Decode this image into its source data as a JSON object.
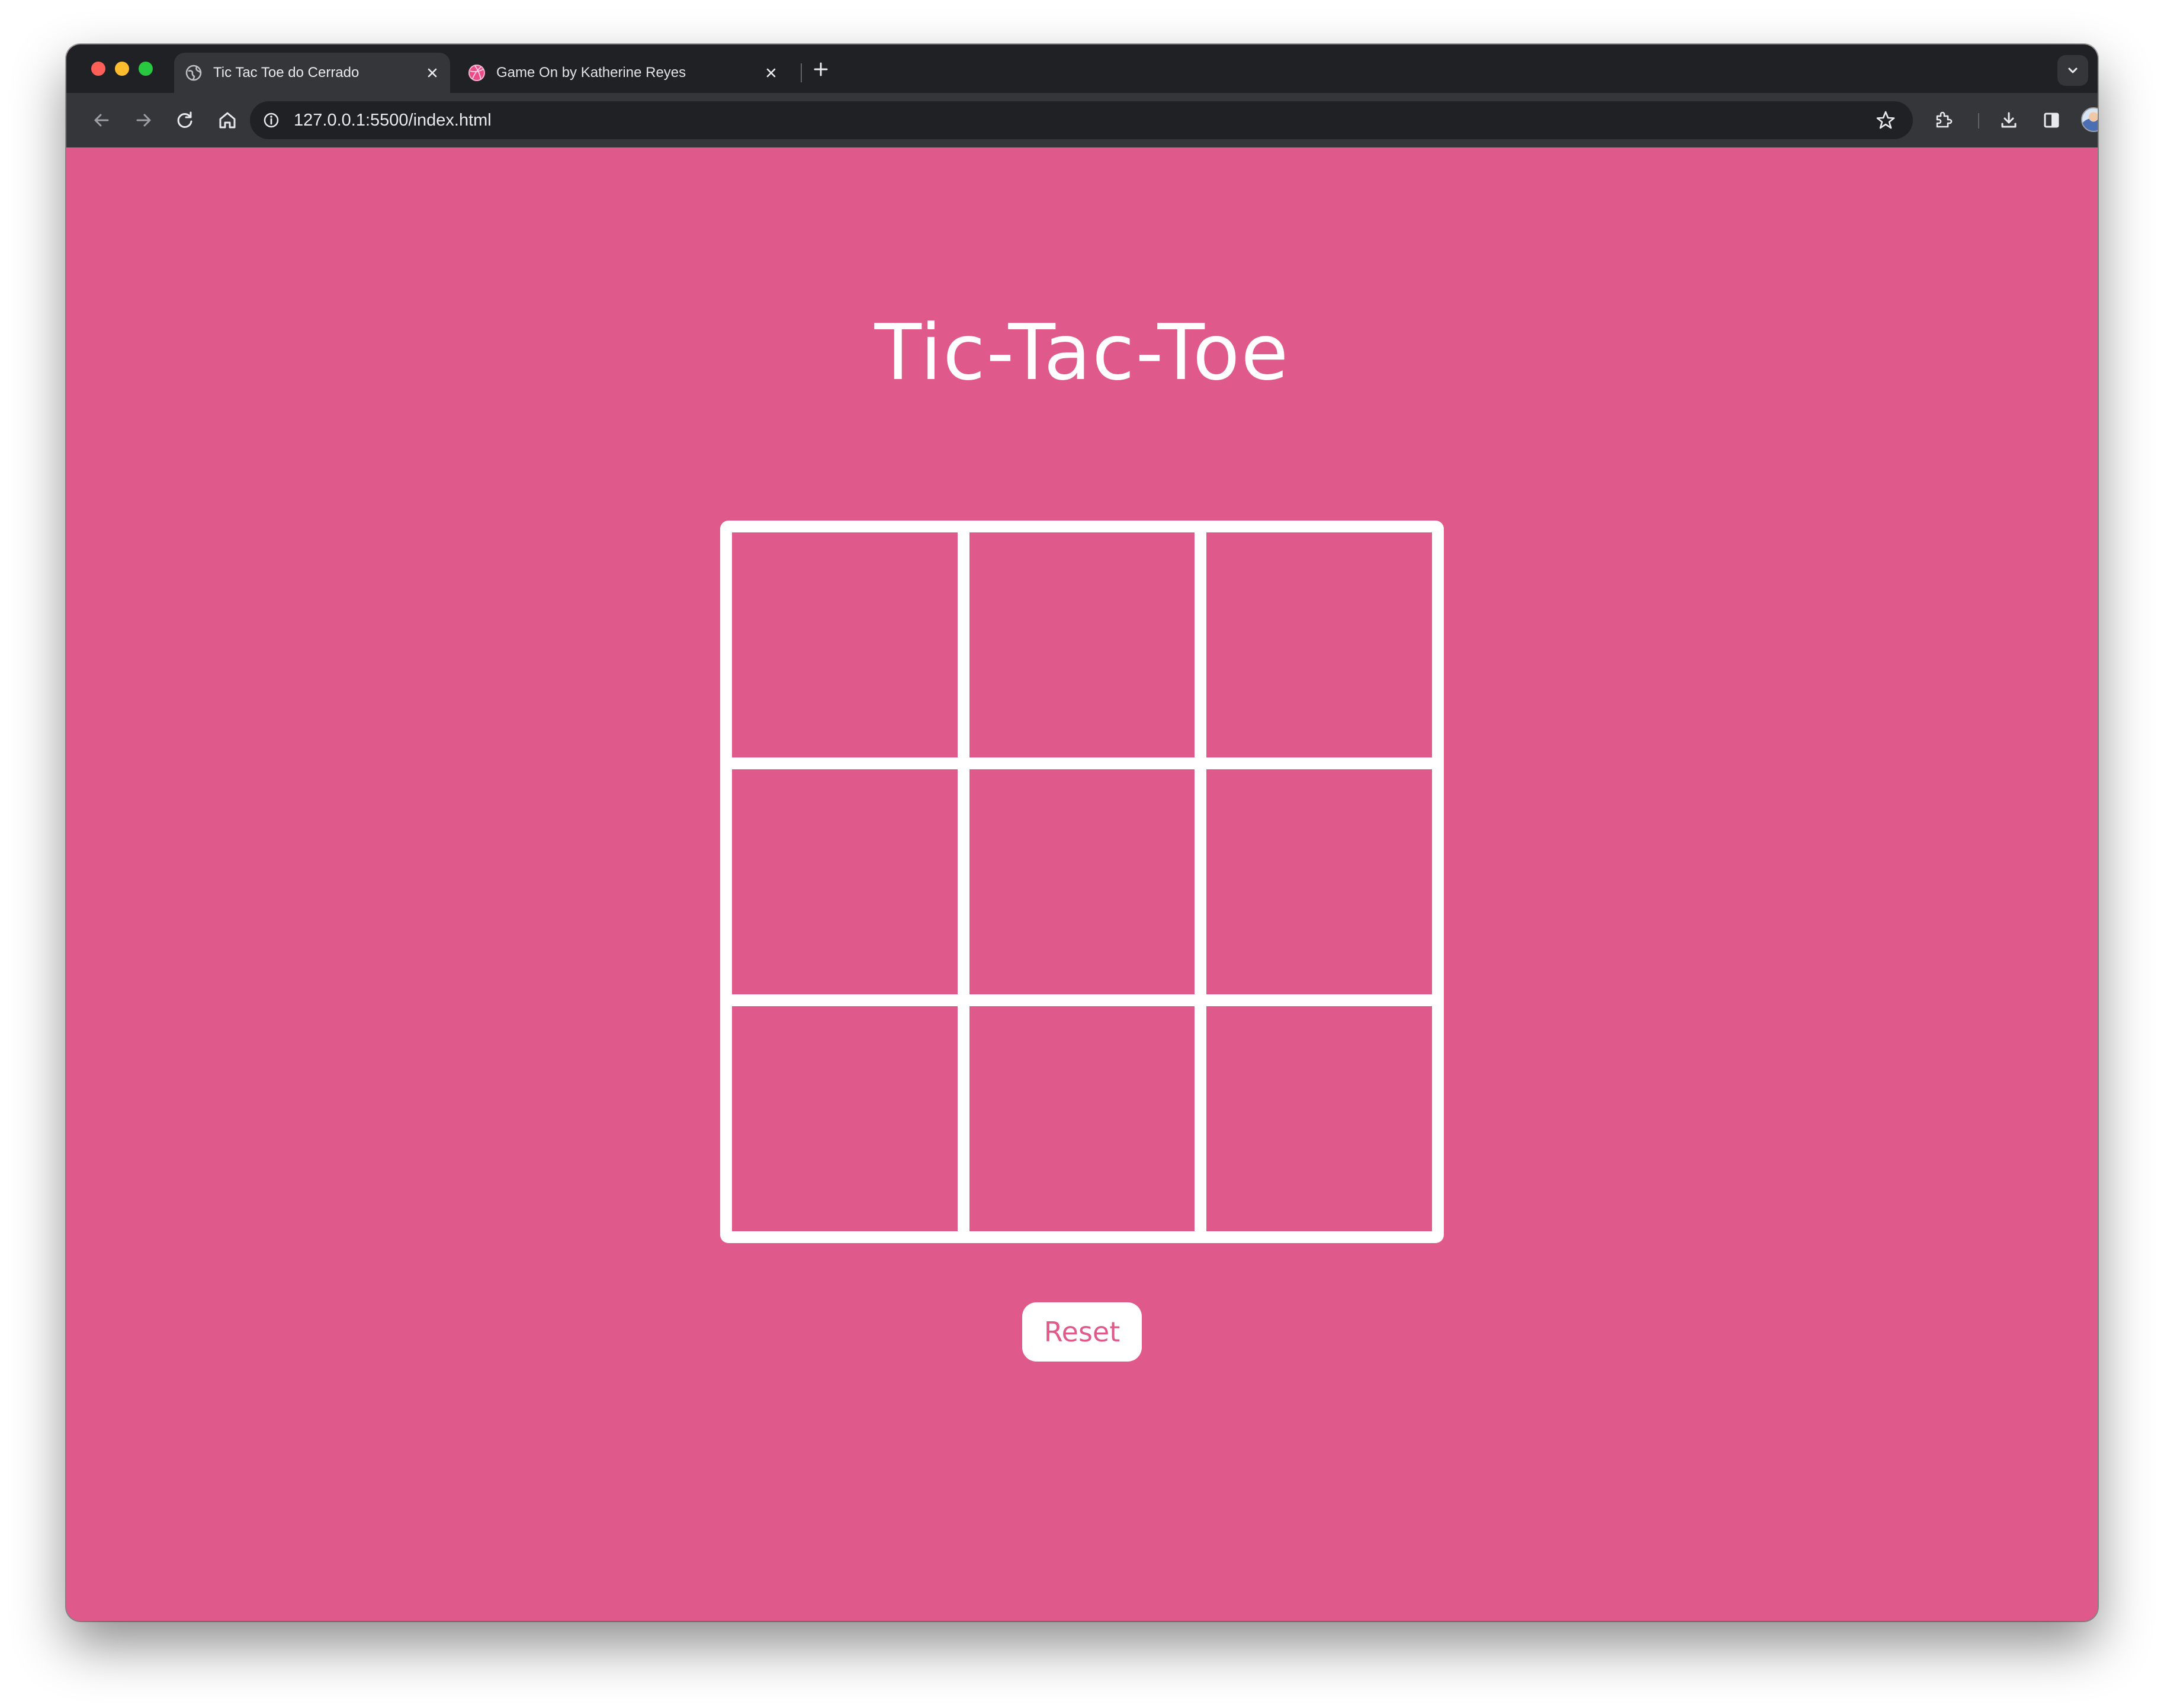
{
  "browser": {
    "tabs": [
      {
        "title": "Tic Tac Toe do Cerrado",
        "active": true,
        "favicon": "globe-icon"
      },
      {
        "title": "Game On by Katherine Reyes",
        "active": false,
        "favicon": "dribbble-icon"
      }
    ],
    "url": "127.0.0.1:5500/index.html"
  },
  "game": {
    "title": "Tic-Tac-Toe",
    "cells": [
      "",
      "",
      "",
      "",
      "",
      "",
      "",
      "",
      ""
    ],
    "reset_label": "Reset"
  },
  "colors": {
    "background": "#df5a8b",
    "foreground": "#ffffff"
  }
}
